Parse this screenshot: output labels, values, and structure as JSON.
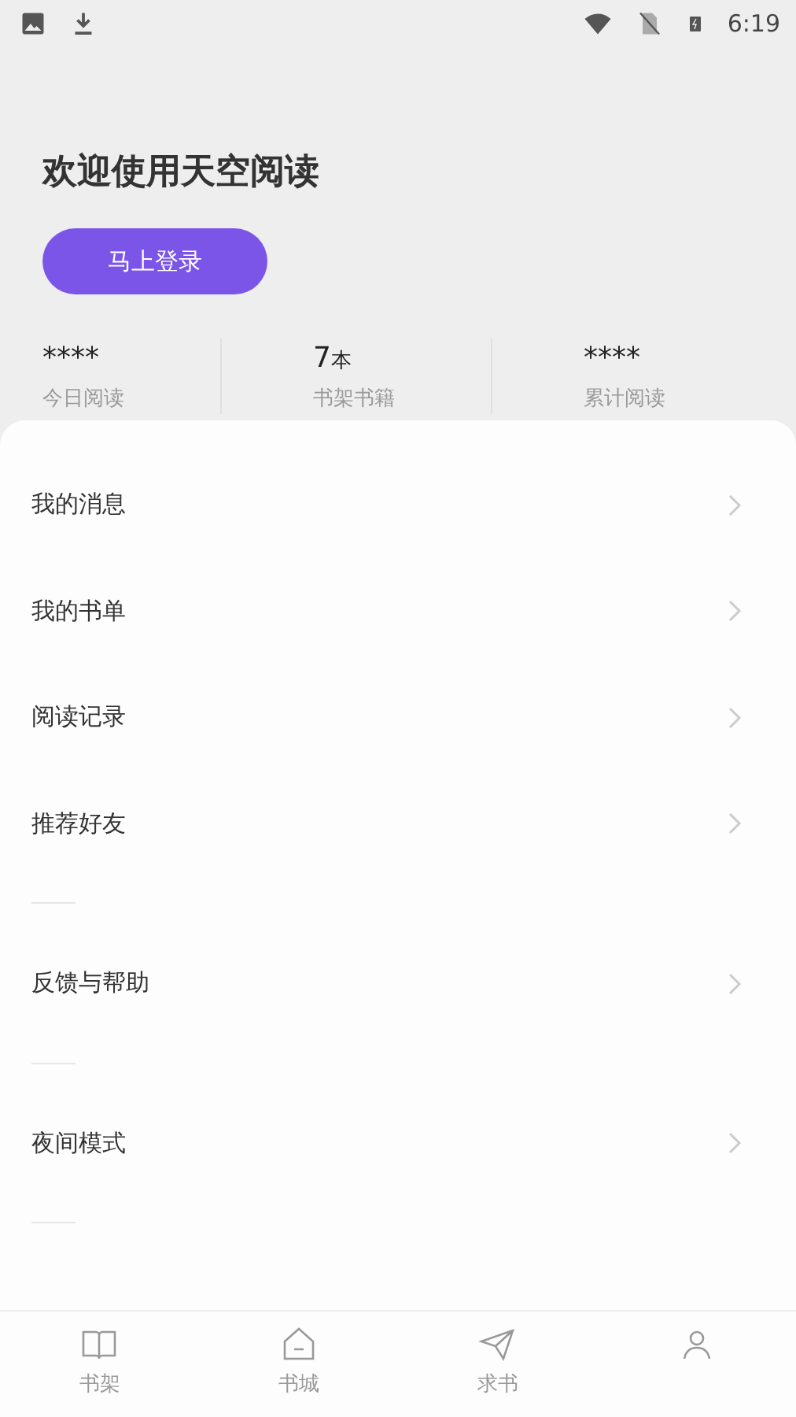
{
  "status_bar": {
    "time": "6:19"
  },
  "header": {
    "title": "欢迎使用天空阅读",
    "login_button": "马上登录"
  },
  "stats": [
    {
      "value": "****",
      "label": "今日阅读"
    },
    {
      "value": "7",
      "unit": "本",
      "label": "书架书籍"
    },
    {
      "value": "****",
      "label": "累计阅读"
    }
  ],
  "menu_groups": [
    {
      "items": [
        {
          "label": "我的消息"
        },
        {
          "label": "我的书单"
        },
        {
          "label": "阅读记录"
        },
        {
          "label": "推荐好友"
        }
      ]
    },
    {
      "items": [
        {
          "label": "反馈与帮助"
        }
      ]
    },
    {
      "items": [
        {
          "label": "夜间模式"
        }
      ]
    }
  ],
  "bottom_nav": [
    {
      "kind": "book",
      "label": "书架"
    },
    {
      "kind": "home",
      "label": "书城"
    },
    {
      "kind": "plane",
      "label": "求书"
    },
    {
      "kind": "person"
    }
  ]
}
